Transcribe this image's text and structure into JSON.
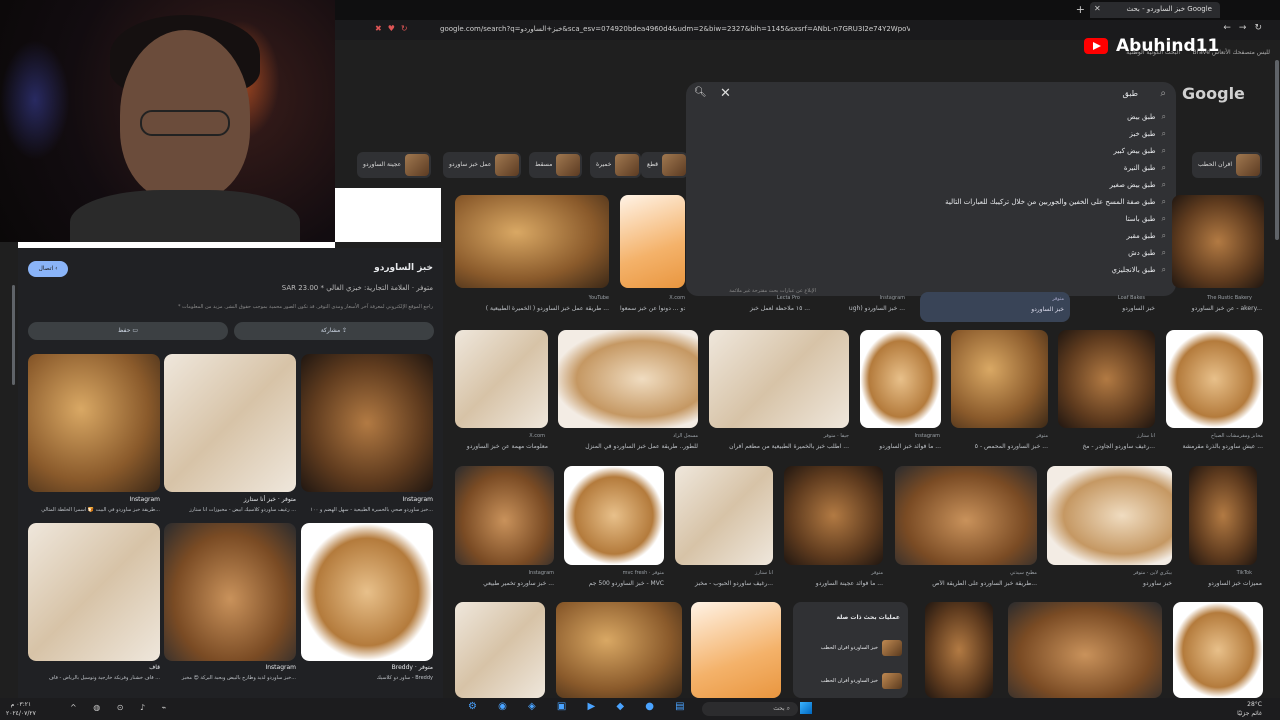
{
  "browser": {
    "tab_title": "خبز الساوردو - بحث Google",
    "url": "google.com/search?q=خبز+الساوردو&sca_esv=074920bdea4960d4&udm=2&biw=2327&bih=1145&sxsrf=ANbL-n7GRU3I2e74Y2WpoVqMyCFT...",
    "bookmarks": [
      "Brave لليس متصفحك الأتعاس",
      "البحث الكونية الوطنية"
    ]
  },
  "stream": {
    "channel_name": "Abuhind11"
  },
  "google": {
    "logo": "Google",
    "search_query": "طبق",
    "suggestions": [
      "طبق بيض",
      "طبق خبز",
      "طبق بيض كبير",
      "طبق النيرة",
      "طبق بيض صغير",
      "طبق صفة المسح على الخفين والجوربين من خلال تركيبك للعبارات التالية",
      "طبق باستا",
      "طبق مقبر",
      "طبق دش",
      "طبق بالانجليزي"
    ],
    "suggestion_footer": "الإبلاغ عن عبارات بحث مقترحة غير ملائمة"
  },
  "chips": [
    "افران الحطب",
    "قطع",
    "خميرة",
    "مسقط",
    "عمل خبز ساوردو",
    "عجينة الساوردو"
  ],
  "panel": {
    "back_label": "اتصال",
    "title": "خبز الساوردو",
    "price": "SAR 23.00 * متوفر · العلامة التجارية: خبزي الغالي",
    "note": "* راجع الموقع الإلكتروني لمعرفة آخر الأسعار ومدى التوفر. قد تكون الصور محمية بموجب حقوق النشر. مزيد من المعلومات",
    "share_label": "مشاركة",
    "save_label": "حفظ",
    "images": [
      {
        "source": "Instagram",
        "caption": "طريقة خبز ساوردو في البيت 🍞 أسمرا الخلطة المثالي..."
      },
      {
        "source": "متوفر · خبز أنا ستارز",
        "caption": "رغيف ساوردو كلاسيك ابيض - مخبوزات انا ستارز ..."
      },
      {
        "source": "Instagram",
        "caption": "خبز ساوردو صحي بالخميرة الطبيعية - سهل الهضم و ١٠٠..."
      },
      {
        "source": "قاف",
        "caption": "قاف خشنار وفرنكة خارجية وتوسيل بالرياض - قاف ..."
      },
      {
        "source": "Instagram",
        "caption": "خبز ساوردو لذيذ وطازج بالبيض وبحبة البركة 😍 مخبز..."
      },
      {
        "source": "Breddy · متوفر",
        "caption": "ساور دو كلاسيك - Breddy"
      }
    ]
  },
  "results": [
    {
      "source": "YouTube",
      "caption": "طريقة عمل خبز الساوردو ( الخميرة الطبيعية ) ..."
    },
    {
      "source": "X.com",
      "caption": "خبز الساوردو ... دونوا عن خبز سمعوا"
    },
    {
      "source": "Lecta Pro",
      "caption": "١٥ ملاحظة لعمل خبز ..."
    },
    {
      "source": "Instagram",
      "caption": "ugh) خبز الساوردو ..."
    },
    {
      "source": "متوفر",
      "caption": "خبز الساوردو"
    },
    {
      "source": "Loaf Bakes",
      "caption": "خبز الساوردو"
    },
    {
      "source": "The Rustic Bakery",
      "caption": "عن خبز الساوردو - akery..."
    },
    {
      "source": "X.com",
      "caption": "معلومات مهمة عن خبز الساوردو"
    },
    {
      "source": "مسجل الزاد",
      "caption": "للطور.. طريقة عمل خبز الساوردو في المنزل"
    },
    {
      "source": "جيفا · متوفر",
      "caption": "اطلب خبز بالخميرة الطبيعية من مطعم أفران ..."
    },
    {
      "source": "Instagram",
      "caption": "ما فوائد خبز الساوردو ..."
    },
    {
      "source": "متوفر",
      "caption": "خبز الساوردو المحمص - ٥ ..."
    },
    {
      "source": "أنا ستارز",
      "caption": "رغيف ساوردو الجاودر - مخ..."
    },
    {
      "source": "مخابز ومقرمشات الصباح",
      "caption": "عيش ساوردو بالذرة مقرمشة ..."
    },
    {
      "source": "Instagram",
      "caption": "خبز ساوردو تخمير طبيعي ..."
    },
    {
      "source": "mvc fresh · متوفر",
      "caption": "خبز الساوردو 500 جم - MVC"
    },
    {
      "source": "أنا ستارز",
      "caption": "رغيف ساوردو الحبوب - مخبز..."
    },
    {
      "source": "متوفر",
      "caption": "ما فوائد عجينة الساوردو ..."
    },
    {
      "source": "مطبخ سيدتي",
      "caption": "طريقة خبز الساوردو على الطريقة الأص..."
    },
    {
      "source": "بيكري لاين · متوفر",
      "caption": "خبز ساوردو"
    },
    {
      "source": "TikTok",
      "caption": "مميزات خبز الساوردو"
    }
  ],
  "related": {
    "title": "عمليات بحث ذات صلة",
    "items": [
      "خبز الساوردو افران الحطب",
      "خبز الساوردو أفران الحطب"
    ]
  },
  "taskbar": {
    "time": "٠٣:٢١ م",
    "date": "٢٠٢٤/٠٧/٢٧",
    "search_label": "بحث",
    "temperature": "28°C",
    "weather": "غائم جزئيًا"
  }
}
